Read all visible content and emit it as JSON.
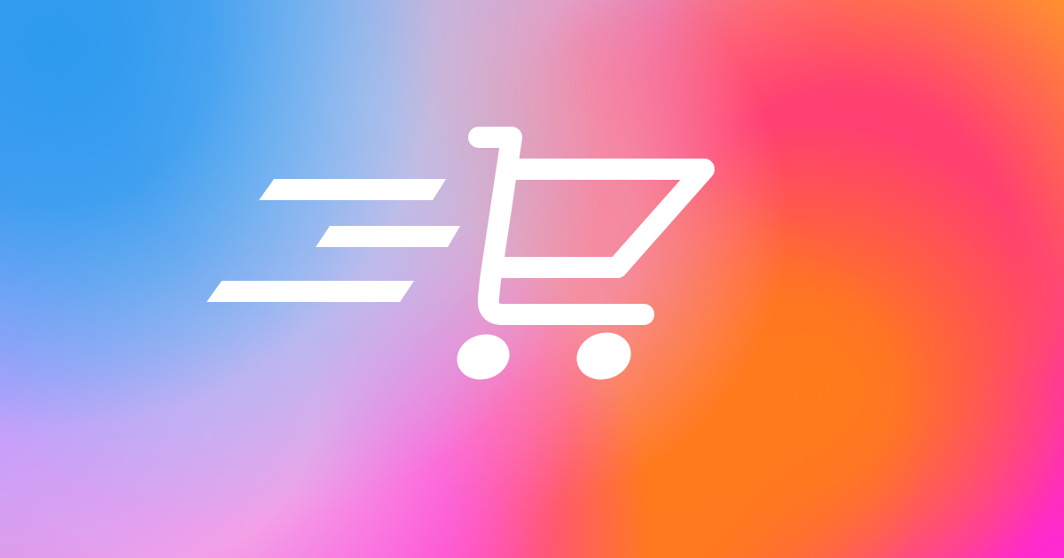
{
  "background": {
    "colors": [
      "#2f9aec",
      "#a9c2ef",
      "#b29cff",
      "#f1a7e7",
      "#ff2fd4",
      "#f28ea6",
      "#ff7b1f",
      "#ff3d73",
      "#ffac1f"
    ]
  },
  "logo": {
    "icon": "shopping-cart-fast-icon",
    "color": "#ffffff"
  }
}
